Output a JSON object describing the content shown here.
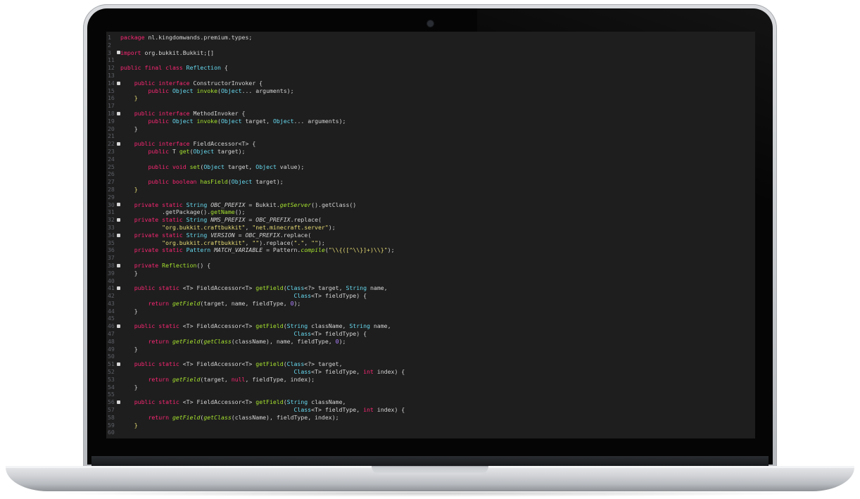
{
  "editor": {
    "language": "java",
    "theme_colors": {
      "background": "#1e1e1e",
      "keyword": "#f92672",
      "type": "#66d9ef",
      "function": "#a6e22e",
      "string": "#e6db74",
      "number": "#ae81ff",
      "plain": "#d4d4d4",
      "line_number": "#5c5f66"
    },
    "lines": [
      {
        "n": "1",
        "fold": false,
        "t": [
          [
            "kw",
            "package"
          ],
          [
            "pl",
            " nl.kingdomwands.premium.types;"
          ]
        ]
      },
      {
        "n": "2",
        "fold": false,
        "t": []
      },
      {
        "n": "3",
        "fold": true,
        "t": [
          [
            "kw",
            "import"
          ],
          [
            "pl",
            " org.bukkit.Bukkit;"
          ],
          [
            "pl",
            "[]"
          ]
        ]
      },
      {
        "n": "11",
        "fold": false,
        "t": []
      },
      {
        "n": "12",
        "fold": false,
        "t": [
          [
            "kw",
            "public final class"
          ],
          [
            "pl",
            " "
          ],
          [
            "cls",
            "Reflection"
          ],
          [
            "pl",
            " {"
          ]
        ]
      },
      {
        "n": "13",
        "fold": false,
        "t": []
      },
      {
        "n": "14",
        "fold": true,
        "t": [
          [
            "pl",
            "    "
          ],
          [
            "kw",
            "public interface"
          ],
          [
            "pl",
            " ConstructorInvoker {"
          ]
        ]
      },
      {
        "n": "15",
        "fold": false,
        "t": [
          [
            "pl",
            "        "
          ],
          [
            "kw",
            "public"
          ],
          [
            "pl",
            " "
          ],
          [
            "ty",
            "Object"
          ],
          [
            "pl",
            " "
          ],
          [
            "fn",
            "invoke"
          ],
          [
            "pl",
            "("
          ],
          [
            "ty",
            "Object"
          ],
          [
            "pl",
            "... arguments);"
          ]
        ]
      },
      {
        "n": "16",
        "fold": false,
        "t": [
          [
            "pl",
            "    "
          ],
          [
            "br",
            "}"
          ]
        ]
      },
      {
        "n": "17",
        "fold": false,
        "t": []
      },
      {
        "n": "18",
        "fold": true,
        "t": [
          [
            "pl",
            "    "
          ],
          [
            "kw",
            "public interface"
          ],
          [
            "pl",
            " MethodInvoker {"
          ]
        ]
      },
      {
        "n": "19",
        "fold": false,
        "t": [
          [
            "pl",
            "        "
          ],
          [
            "kw",
            "public"
          ],
          [
            "pl",
            " "
          ],
          [
            "ty",
            "Object"
          ],
          [
            "pl",
            " "
          ],
          [
            "fn",
            "invoke"
          ],
          [
            "pl",
            "("
          ],
          [
            "ty",
            "Object"
          ],
          [
            "pl",
            " target, "
          ],
          [
            "ty",
            "Object"
          ],
          [
            "pl",
            "... arguments);"
          ]
        ]
      },
      {
        "n": "20",
        "fold": false,
        "t": [
          [
            "pl",
            "    }"
          ]
        ]
      },
      {
        "n": "21",
        "fold": false,
        "t": []
      },
      {
        "n": "22",
        "fold": true,
        "t": [
          [
            "pl",
            "    "
          ],
          [
            "kw",
            "public interface"
          ],
          [
            "pl",
            " FieldAccessor<T> {"
          ]
        ]
      },
      {
        "n": "23",
        "fold": false,
        "t": [
          [
            "pl",
            "        "
          ],
          [
            "kw",
            "public"
          ],
          [
            "pl",
            " T "
          ],
          [
            "fn",
            "get"
          ],
          [
            "pl",
            "("
          ],
          [
            "ty",
            "Object"
          ],
          [
            "pl",
            " target);"
          ]
        ]
      },
      {
        "n": "24",
        "fold": false,
        "t": []
      },
      {
        "n": "25",
        "fold": false,
        "t": [
          [
            "pl",
            "        "
          ],
          [
            "kw",
            "public void"
          ],
          [
            "pl",
            " "
          ],
          [
            "fn",
            "set"
          ],
          [
            "pl",
            "("
          ],
          [
            "ty",
            "Object"
          ],
          [
            "pl",
            " target, "
          ],
          [
            "ty",
            "Object"
          ],
          [
            "pl",
            " value);"
          ]
        ]
      },
      {
        "n": "26",
        "fold": false,
        "t": []
      },
      {
        "n": "27",
        "fold": false,
        "t": [
          [
            "pl",
            "        "
          ],
          [
            "kw",
            "public boolean"
          ],
          [
            "pl",
            " "
          ],
          [
            "fn",
            "hasField"
          ],
          [
            "pl",
            "("
          ],
          [
            "ty",
            "Object"
          ],
          [
            "pl",
            " target);"
          ]
        ]
      },
      {
        "n": "28",
        "fold": false,
        "t": [
          [
            "pl",
            "    "
          ],
          [
            "br",
            "}"
          ]
        ]
      },
      {
        "n": "29",
        "fold": false,
        "t": []
      },
      {
        "n": "30",
        "fold": true,
        "t": [
          [
            "pl",
            "    "
          ],
          [
            "kw",
            "private static"
          ],
          [
            "pl",
            " "
          ],
          [
            "ty",
            "String"
          ],
          [
            "pl",
            " "
          ],
          [
            "cn",
            "OBC_PREFIX"
          ],
          [
            "pl",
            " = Bukkit."
          ],
          [
            "fni",
            "getServer"
          ],
          [
            "pl",
            "().getClass()"
          ]
        ]
      },
      {
        "n": "31",
        "fold": false,
        "t": [
          [
            "pl",
            "            .getPackage()."
          ],
          [
            "fn",
            "getName"
          ],
          [
            "pl",
            "();"
          ]
        ]
      },
      {
        "n": "32",
        "fold": true,
        "t": [
          [
            "pl",
            "    "
          ],
          [
            "kw",
            "private static"
          ],
          [
            "pl",
            " "
          ],
          [
            "ty",
            "String"
          ],
          [
            "pl",
            " "
          ],
          [
            "cn",
            "NMS_PREFIX"
          ],
          [
            "pl",
            " = "
          ],
          [
            "cn",
            "OBC_PREFIX"
          ],
          [
            "pl",
            ".replace("
          ]
        ]
      },
      {
        "n": "33",
        "fold": false,
        "t": [
          [
            "pl",
            "            "
          ],
          [
            "st",
            "\"org.bukkit.craftbukkit\""
          ],
          [
            "pl",
            ", "
          ],
          [
            "st",
            "\"net.minecraft.server\""
          ],
          [
            "pl",
            ");"
          ]
        ]
      },
      {
        "n": "34",
        "fold": true,
        "t": [
          [
            "pl",
            "    "
          ],
          [
            "kw",
            "private static"
          ],
          [
            "pl",
            " "
          ],
          [
            "ty",
            "String"
          ],
          [
            "pl",
            " "
          ],
          [
            "cn",
            "VERSION"
          ],
          [
            "pl",
            " = "
          ],
          [
            "cn",
            "OBC_PREFIX"
          ],
          [
            "pl",
            ".replace("
          ]
        ]
      },
      {
        "n": "35",
        "fold": false,
        "t": [
          [
            "pl",
            "            "
          ],
          [
            "st",
            "\"org.bukkit.craftbukkit\""
          ],
          [
            "pl",
            ", "
          ],
          [
            "st",
            "\"\""
          ],
          [
            "pl",
            ").replace("
          ],
          [
            "st",
            "\".\""
          ],
          [
            "pl",
            ", "
          ],
          [
            "st",
            "\"\""
          ],
          [
            "pl",
            ");"
          ]
        ]
      },
      {
        "n": "36",
        "fold": false,
        "t": [
          [
            "pl",
            "    "
          ],
          [
            "kw",
            "private static"
          ],
          [
            "pl",
            " "
          ],
          [
            "ty",
            "Pattern"
          ],
          [
            "pl",
            " "
          ],
          [
            "cn",
            "MATCH_VARIABLE"
          ],
          [
            "pl",
            " = Pattern."
          ],
          [
            "fni",
            "compile"
          ],
          [
            "pl",
            "("
          ],
          [
            "st",
            "\"\\\\{([^\\\\}]+)\\\\}\""
          ],
          [
            "pl",
            ");"
          ]
        ]
      },
      {
        "n": "37",
        "fold": false,
        "t": []
      },
      {
        "n": "38",
        "fold": true,
        "t": [
          [
            "pl",
            "    "
          ],
          [
            "kw",
            "private"
          ],
          [
            "pl",
            " "
          ],
          [
            "fn",
            "Reflection"
          ],
          [
            "pl",
            "() {"
          ]
        ]
      },
      {
        "n": "39",
        "fold": false,
        "t": [
          [
            "pl",
            "    }"
          ]
        ]
      },
      {
        "n": "40",
        "fold": false,
        "t": []
      },
      {
        "n": "41",
        "fold": true,
        "t": [
          [
            "pl",
            "    "
          ],
          [
            "kw",
            "public static"
          ],
          [
            "pl",
            " <T> FieldAccessor<T> "
          ],
          [
            "fn",
            "getField"
          ],
          [
            "pl",
            "("
          ],
          [
            "ty",
            "Class"
          ],
          [
            "pl",
            "<?> target, "
          ],
          [
            "ty",
            "String"
          ],
          [
            "pl",
            " name,"
          ]
        ]
      },
      {
        "n": "42",
        "fold": false,
        "t": [
          [
            "pl",
            "                                                  "
          ],
          [
            "ty",
            "Class"
          ],
          [
            "pl",
            "<T> fieldType) {"
          ]
        ]
      },
      {
        "n": "43",
        "fold": false,
        "t": [
          [
            "pl",
            "        "
          ],
          [
            "kw",
            "return"
          ],
          [
            "pl",
            " "
          ],
          [
            "fni",
            "getField"
          ],
          [
            "pl",
            "(target, name, fieldType, "
          ],
          [
            "nm",
            "0"
          ],
          [
            "pl",
            ");"
          ]
        ]
      },
      {
        "n": "44",
        "fold": false,
        "t": [
          [
            "pl",
            "    }"
          ]
        ]
      },
      {
        "n": "45",
        "fold": false,
        "t": []
      },
      {
        "n": "46",
        "fold": true,
        "t": [
          [
            "pl",
            "    "
          ],
          [
            "kw",
            "public static"
          ],
          [
            "pl",
            " <T> FieldAccessor<T> "
          ],
          [
            "fn",
            "getField"
          ],
          [
            "pl",
            "("
          ],
          [
            "ty",
            "String"
          ],
          [
            "pl",
            " className, "
          ],
          [
            "ty",
            "String"
          ],
          [
            "pl",
            " name,"
          ]
        ]
      },
      {
        "n": "47",
        "fold": false,
        "t": [
          [
            "pl",
            "                                                  "
          ],
          [
            "ty",
            "Class"
          ],
          [
            "pl",
            "<T> fieldType) {"
          ]
        ]
      },
      {
        "n": "48",
        "fold": false,
        "t": [
          [
            "pl",
            "        "
          ],
          [
            "kw",
            "return"
          ],
          [
            "pl",
            " "
          ],
          [
            "fni",
            "getField"
          ],
          [
            "pl",
            "("
          ],
          [
            "fni",
            "getClass"
          ],
          [
            "pl",
            "(className), name, fieldType, "
          ],
          [
            "nm",
            "0"
          ],
          [
            "pl",
            ");"
          ]
        ]
      },
      {
        "n": "49",
        "fold": false,
        "t": [
          [
            "pl",
            "    }"
          ]
        ]
      },
      {
        "n": "50",
        "fold": false,
        "t": []
      },
      {
        "n": "51",
        "fold": true,
        "t": [
          [
            "pl",
            "    "
          ],
          [
            "kw",
            "public static"
          ],
          [
            "pl",
            " <T> FieldAccessor<T> "
          ],
          [
            "fn",
            "getField"
          ],
          [
            "pl",
            "("
          ],
          [
            "ty",
            "Class"
          ],
          [
            "pl",
            "<?> target,"
          ]
        ]
      },
      {
        "n": "52",
        "fold": false,
        "t": [
          [
            "pl",
            "                                                  "
          ],
          [
            "ty",
            "Class"
          ],
          [
            "pl",
            "<T> fieldType, "
          ],
          [
            "kw",
            "int"
          ],
          [
            "pl",
            " index) {"
          ]
        ]
      },
      {
        "n": "53",
        "fold": false,
        "t": [
          [
            "pl",
            "        "
          ],
          [
            "kw",
            "return"
          ],
          [
            "pl",
            " "
          ],
          [
            "fni",
            "getField"
          ],
          [
            "pl",
            "(target, "
          ],
          [
            "kw",
            "null"
          ],
          [
            "pl",
            ", fieldType, index);"
          ]
        ]
      },
      {
        "n": "54",
        "fold": false,
        "t": [
          [
            "pl",
            "    }"
          ]
        ]
      },
      {
        "n": "55",
        "fold": false,
        "t": []
      },
      {
        "n": "56",
        "fold": true,
        "t": [
          [
            "pl",
            "    "
          ],
          [
            "kw",
            "public static"
          ],
          [
            "pl",
            " <T> FieldAccessor<T> "
          ],
          [
            "fn",
            "getField"
          ],
          [
            "pl",
            "("
          ],
          [
            "ty",
            "String"
          ],
          [
            "pl",
            " className,"
          ]
        ]
      },
      {
        "n": "57",
        "fold": false,
        "t": [
          [
            "pl",
            "                                                  "
          ],
          [
            "ty",
            "Class"
          ],
          [
            "pl",
            "<T> fieldType, "
          ],
          [
            "kw",
            "int"
          ],
          [
            "pl",
            " index) {"
          ]
        ]
      },
      {
        "n": "58",
        "fold": false,
        "t": [
          [
            "pl",
            "        "
          ],
          [
            "kw",
            "return"
          ],
          [
            "pl",
            " "
          ],
          [
            "fni",
            "getField"
          ],
          [
            "pl",
            "("
          ],
          [
            "fni",
            "getClass"
          ],
          [
            "pl",
            "(className), fieldType, index);"
          ]
        ]
      },
      {
        "n": "59",
        "fold": false,
        "t": [
          [
            "pl",
            "    "
          ],
          [
            "br",
            "}"
          ]
        ]
      },
      {
        "n": "60",
        "fold": false,
        "t": []
      }
    ]
  }
}
